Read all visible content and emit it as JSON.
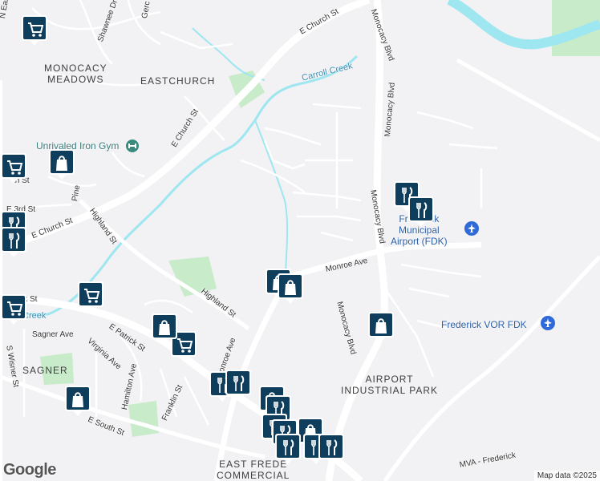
{
  "map": {
    "areas": [
      "MONOCACY",
      "MEADOWS",
      "EASTCHURCH",
      "SAGNER",
      "AIRPORT",
      "INDUSTRIAL PARK",
      "EAST FREDE",
      "COMMERCIAL"
    ],
    "roads": {
      "n_east": "N East",
      "shawnee": "Shawnee Dr",
      "gerc": "Gerc",
      "e_church_top": "E Church St",
      "monocacy_blvd_top": "Monocacy Blvd",
      "monocacy_blvd_mid": "Monocacy Blvd",
      "monocacy_blvd_low": "Monocacy Blvd",
      "e_church_mid": "E Church St",
      "e_church_left": "E Church St",
      "th_st": "th St",
      "pine": "Pine",
      "e_3rd": "E 3rd St",
      "highland_st": "Highland St",
      "highland_st2": "Highland St",
      "monroe_ave": "Monroe Ave",
      "monroe_ave2": "Monroe Ave",
      "ick_st": "ick St",
      "sagner_ave": "Sagner Ave",
      "e_patrick": "E Patrick St",
      "virginia": "Virginia Ave",
      "s_wisner": "S Wisner St",
      "hamilton": "Hamilton Ave",
      "franklin": "Franklin St",
      "e_south": "E South St",
      "mva": "MVA - Frederick"
    },
    "water": {
      "carroll_creek": "Carroll Creek",
      "creek_left": "Creek"
    },
    "pois": {
      "gym": "Unrivaled Iron Gym"
    },
    "airports": {
      "fdk": [
        "Frederick",
        "Municipal",
        "Airport (FDK)"
      ],
      "vor": "Frederick VOR FDK"
    },
    "attribution": "Map data ©2025",
    "brand": "Google",
    "colors": {
      "marker": "#0f3d5c",
      "water": "#9ee6f0",
      "park": "#c8ebc9",
      "airport_icon": "#2f6bd8"
    }
  }
}
